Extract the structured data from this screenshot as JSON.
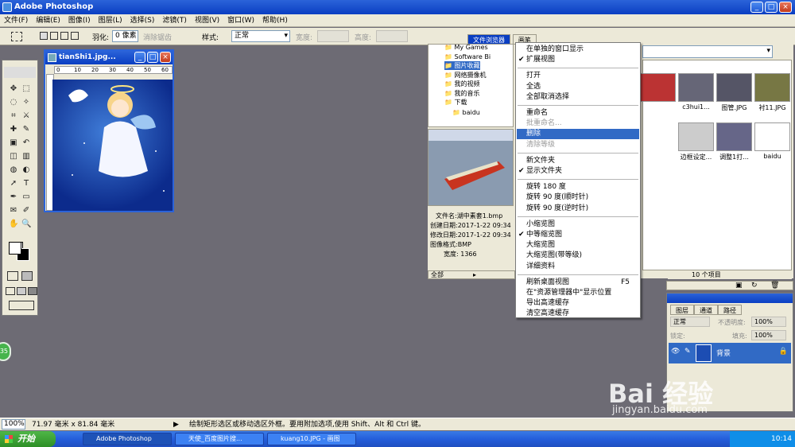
{
  "window": {
    "title": "Adobe Photoshop",
    "min": "_",
    "max": "□",
    "close": "×"
  },
  "menubar": [
    "文件(F)",
    "编辑(E)",
    "图像(I)",
    "图层(L)",
    "选择(S)",
    "滤镜(T)",
    "视图(V)",
    "窗口(W)",
    "帮助(H)"
  ],
  "options": {
    "feather_label": "羽化:",
    "feather_value": "0 像素",
    "antialias_label": "消除锯齿",
    "style_label": "样式:",
    "style_value": "正常",
    "width_label": "宽度:",
    "height_label": "高度:"
  },
  "panel_tabs": {
    "browser": "文件浏览器",
    "brushes": "画笔"
  },
  "document": {
    "title": "tianShi1.jpg...",
    "ruler_top": [
      "0",
      "10",
      "20",
      "30",
      "40",
      "50",
      "60"
    ]
  },
  "tree": {
    "items": [
      "My Games",
      "Software Bi",
      "图片收藏",
      "网络摄像机",
      "我的视频",
      "我的音乐",
      "下载",
      "baidu"
    ],
    "selected": "图片收藏"
  },
  "fileinfo": {
    "filename_label": "文件名:",
    "filename": "湖中素套1.bmp",
    "created_label": "创建日期:",
    "created": "2017-1-22 09:34",
    "modified_label": "修改日期:",
    "modified": "2017-1-22 09:34",
    "format_label": "图像格式:",
    "format": "BMP",
    "width_label": "宽度:",
    "width": "1366"
  },
  "browser_footer": {
    "filter": "全部",
    "count": "10 个项目"
  },
  "thumbnails": [
    {
      "label": "",
      "color": "#b33"
    },
    {
      "label": "c3hui1...",
      "color": "#667"
    },
    {
      "label": "图管.JPG",
      "color": "#556"
    },
    {
      "label": "衬11.JPG",
      "color": "#774"
    },
    {
      "label": "边框设定...",
      "color": "#ccc"
    },
    {
      "label": "调整1打...",
      "color": "#668"
    },
    {
      "label": "baidu",
      "color": "#fff"
    }
  ],
  "context_menu": [
    {
      "label": "在单独的窗口显示"
    },
    {
      "label": "扩展视图",
      "check": true
    },
    {
      "sep": true
    },
    {
      "label": "打开"
    },
    {
      "label": "全选"
    },
    {
      "label": "全部取消选择"
    },
    {
      "sep": true
    },
    {
      "label": "重命名"
    },
    {
      "label": "批重命名...",
      "disabled": true
    },
    {
      "label": "删除",
      "highlight": true
    },
    {
      "label": "清除等级",
      "disabled": true
    },
    {
      "sep": true
    },
    {
      "label": "新文件夹"
    },
    {
      "label": "显示文件夹",
      "check": true
    },
    {
      "sep": true
    },
    {
      "label": "旋转 180 度"
    },
    {
      "label": "旋转 90 度(顺时针)"
    },
    {
      "label": "旋转 90 度(逆时针)"
    },
    {
      "sep": true
    },
    {
      "label": "小缩览图"
    },
    {
      "label": "中等缩览图",
      "check": true
    },
    {
      "label": "大缩览图"
    },
    {
      "label": "大缩览图(带等级)"
    },
    {
      "label": "详细资料"
    },
    {
      "sep": true
    },
    {
      "label": "刷新桌面视图",
      "shortcut": "F5"
    },
    {
      "label": "在\"资源管理器中\"显示位置"
    },
    {
      "label": "导出高速缓存"
    },
    {
      "label": "清空高速缓存"
    }
  ],
  "layers": {
    "tabs": [
      "图层",
      "通道",
      "路径"
    ],
    "blend": "正常",
    "opacity_label": "不透明度:",
    "opacity": "100%",
    "lock_label": "锁定:",
    "fill_label": "填充:",
    "fill": "100%",
    "layer_name": "背景"
  },
  "status": {
    "zoom": "100%",
    "size": "71.97 毫米 x 81.84 毫米",
    "hint": "绘制矩形选区或移动选区外框。要用附加选项,使用 Shift、Alt 和 Ctrl 键。"
  },
  "taskbar": {
    "start": "开始",
    "tasks": [
      "Adobe Photoshop",
      "天使_百度图片搜...",
      "kuang10.JPG - 画图"
    ],
    "time": "10:14"
  },
  "watermark": {
    "brand": "Bai 经验",
    "url": "jingyan.baidu.com"
  },
  "badge": "35"
}
